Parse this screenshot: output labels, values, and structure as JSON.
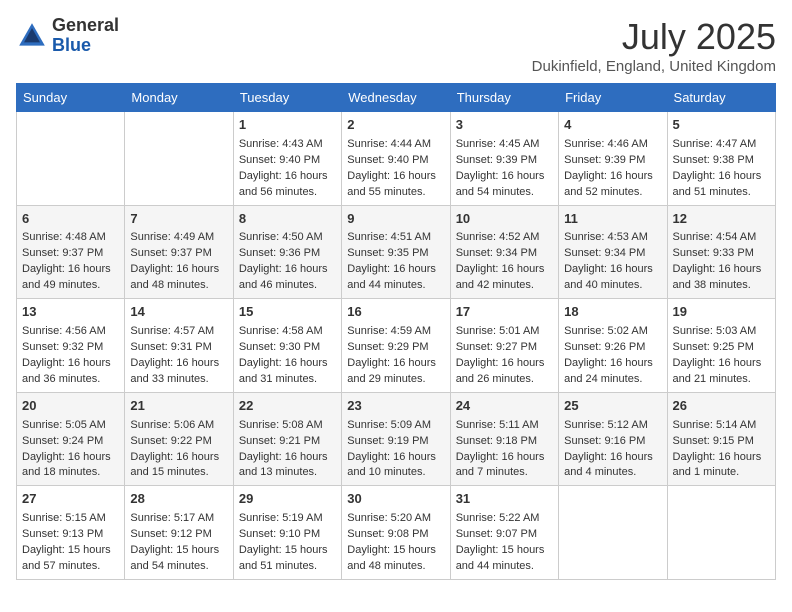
{
  "logo": {
    "general": "General",
    "blue": "Blue"
  },
  "title": {
    "month_year": "July 2025",
    "location": "Dukinfield, England, United Kingdom"
  },
  "headers": [
    "Sunday",
    "Monday",
    "Tuesday",
    "Wednesday",
    "Thursday",
    "Friday",
    "Saturday"
  ],
  "weeks": [
    [
      {
        "day": "",
        "sunrise": "",
        "sunset": "",
        "daylight": ""
      },
      {
        "day": "",
        "sunrise": "",
        "sunset": "",
        "daylight": ""
      },
      {
        "day": "1",
        "sunrise": "Sunrise: 4:43 AM",
        "sunset": "Sunset: 9:40 PM",
        "daylight": "Daylight: 16 hours and 56 minutes."
      },
      {
        "day": "2",
        "sunrise": "Sunrise: 4:44 AM",
        "sunset": "Sunset: 9:40 PM",
        "daylight": "Daylight: 16 hours and 55 minutes."
      },
      {
        "day": "3",
        "sunrise": "Sunrise: 4:45 AM",
        "sunset": "Sunset: 9:39 PM",
        "daylight": "Daylight: 16 hours and 54 minutes."
      },
      {
        "day": "4",
        "sunrise": "Sunrise: 4:46 AM",
        "sunset": "Sunset: 9:39 PM",
        "daylight": "Daylight: 16 hours and 52 minutes."
      },
      {
        "day": "5",
        "sunrise": "Sunrise: 4:47 AM",
        "sunset": "Sunset: 9:38 PM",
        "daylight": "Daylight: 16 hours and 51 minutes."
      }
    ],
    [
      {
        "day": "6",
        "sunrise": "Sunrise: 4:48 AM",
        "sunset": "Sunset: 9:37 PM",
        "daylight": "Daylight: 16 hours and 49 minutes."
      },
      {
        "day": "7",
        "sunrise": "Sunrise: 4:49 AM",
        "sunset": "Sunset: 9:37 PM",
        "daylight": "Daylight: 16 hours and 48 minutes."
      },
      {
        "day": "8",
        "sunrise": "Sunrise: 4:50 AM",
        "sunset": "Sunset: 9:36 PM",
        "daylight": "Daylight: 16 hours and 46 minutes."
      },
      {
        "day": "9",
        "sunrise": "Sunrise: 4:51 AM",
        "sunset": "Sunset: 9:35 PM",
        "daylight": "Daylight: 16 hours and 44 minutes."
      },
      {
        "day": "10",
        "sunrise": "Sunrise: 4:52 AM",
        "sunset": "Sunset: 9:34 PM",
        "daylight": "Daylight: 16 hours and 42 minutes."
      },
      {
        "day": "11",
        "sunrise": "Sunrise: 4:53 AM",
        "sunset": "Sunset: 9:34 PM",
        "daylight": "Daylight: 16 hours and 40 minutes."
      },
      {
        "day": "12",
        "sunrise": "Sunrise: 4:54 AM",
        "sunset": "Sunset: 9:33 PM",
        "daylight": "Daylight: 16 hours and 38 minutes."
      }
    ],
    [
      {
        "day": "13",
        "sunrise": "Sunrise: 4:56 AM",
        "sunset": "Sunset: 9:32 PM",
        "daylight": "Daylight: 16 hours and 36 minutes."
      },
      {
        "day": "14",
        "sunrise": "Sunrise: 4:57 AM",
        "sunset": "Sunset: 9:31 PM",
        "daylight": "Daylight: 16 hours and 33 minutes."
      },
      {
        "day": "15",
        "sunrise": "Sunrise: 4:58 AM",
        "sunset": "Sunset: 9:30 PM",
        "daylight": "Daylight: 16 hours and 31 minutes."
      },
      {
        "day": "16",
        "sunrise": "Sunrise: 4:59 AM",
        "sunset": "Sunset: 9:29 PM",
        "daylight": "Daylight: 16 hours and 29 minutes."
      },
      {
        "day": "17",
        "sunrise": "Sunrise: 5:01 AM",
        "sunset": "Sunset: 9:27 PM",
        "daylight": "Daylight: 16 hours and 26 minutes."
      },
      {
        "day": "18",
        "sunrise": "Sunrise: 5:02 AM",
        "sunset": "Sunset: 9:26 PM",
        "daylight": "Daylight: 16 hours and 24 minutes."
      },
      {
        "day": "19",
        "sunrise": "Sunrise: 5:03 AM",
        "sunset": "Sunset: 9:25 PM",
        "daylight": "Daylight: 16 hours and 21 minutes."
      }
    ],
    [
      {
        "day": "20",
        "sunrise": "Sunrise: 5:05 AM",
        "sunset": "Sunset: 9:24 PM",
        "daylight": "Daylight: 16 hours and 18 minutes."
      },
      {
        "day": "21",
        "sunrise": "Sunrise: 5:06 AM",
        "sunset": "Sunset: 9:22 PM",
        "daylight": "Daylight: 16 hours and 15 minutes."
      },
      {
        "day": "22",
        "sunrise": "Sunrise: 5:08 AM",
        "sunset": "Sunset: 9:21 PM",
        "daylight": "Daylight: 16 hours and 13 minutes."
      },
      {
        "day": "23",
        "sunrise": "Sunrise: 5:09 AM",
        "sunset": "Sunset: 9:19 PM",
        "daylight": "Daylight: 16 hours and 10 minutes."
      },
      {
        "day": "24",
        "sunrise": "Sunrise: 5:11 AM",
        "sunset": "Sunset: 9:18 PM",
        "daylight": "Daylight: 16 hours and 7 minutes."
      },
      {
        "day": "25",
        "sunrise": "Sunrise: 5:12 AM",
        "sunset": "Sunset: 9:16 PM",
        "daylight": "Daylight: 16 hours and 4 minutes."
      },
      {
        "day": "26",
        "sunrise": "Sunrise: 5:14 AM",
        "sunset": "Sunset: 9:15 PM",
        "daylight": "Daylight: 16 hours and 1 minute."
      }
    ],
    [
      {
        "day": "27",
        "sunrise": "Sunrise: 5:15 AM",
        "sunset": "Sunset: 9:13 PM",
        "daylight": "Daylight: 15 hours and 57 minutes."
      },
      {
        "day": "28",
        "sunrise": "Sunrise: 5:17 AM",
        "sunset": "Sunset: 9:12 PM",
        "daylight": "Daylight: 15 hours and 54 minutes."
      },
      {
        "day": "29",
        "sunrise": "Sunrise: 5:19 AM",
        "sunset": "Sunset: 9:10 PM",
        "daylight": "Daylight: 15 hours and 51 minutes."
      },
      {
        "day": "30",
        "sunrise": "Sunrise: 5:20 AM",
        "sunset": "Sunset: 9:08 PM",
        "daylight": "Daylight: 15 hours and 48 minutes."
      },
      {
        "day": "31",
        "sunrise": "Sunrise: 5:22 AM",
        "sunset": "Sunset: 9:07 PM",
        "daylight": "Daylight: 15 hours and 44 minutes."
      },
      {
        "day": "",
        "sunrise": "",
        "sunset": "",
        "daylight": ""
      },
      {
        "day": "",
        "sunrise": "",
        "sunset": "",
        "daylight": ""
      }
    ]
  ]
}
